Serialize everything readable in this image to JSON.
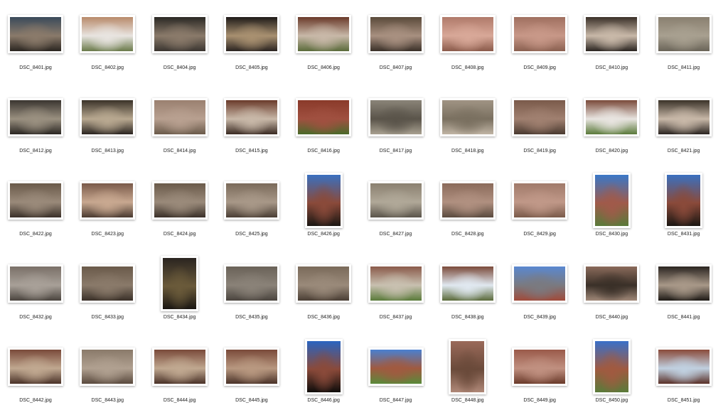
{
  "files": [
    {
      "name": "DSC_8401.jpg",
      "orientation": "landscape",
      "colors": [
        "#3a4a5a",
        "#8a7a6a",
        "#2a2520"
      ]
    },
    {
      "name": "DSC_8402.jpg",
      "orientation": "landscape",
      "colors": [
        "#b88a6a",
        "#e8e4e0",
        "#6a7a4a"
      ]
    },
    {
      "name": "DSC_8404.jpg",
      "orientation": "landscape",
      "colors": [
        "#2a2824",
        "#8a7a6a",
        "#3a3530"
      ]
    },
    {
      "name": "DSC_8405.jpg",
      "orientation": "landscape",
      "colors": [
        "#1e1a18",
        "#a89070",
        "#2a2420"
      ]
    },
    {
      "name": "DSC_8406.jpg",
      "orientation": "landscape",
      "colors": [
        "#6a3a2a",
        "#c8b8a8",
        "#5a6a3a"
      ]
    },
    {
      "name": "DSC_8407.jpg",
      "orientation": "landscape",
      "colors": [
        "#5a4a3a",
        "#a89080",
        "#3a3028"
      ]
    },
    {
      "name": "DSC_8408.jpg",
      "orientation": "landscape",
      "colors": [
        "#b07a6a",
        "#d8a898",
        "#8a5a4a"
      ]
    },
    {
      "name": "DSC_8409.jpg",
      "orientation": "landscape",
      "colors": [
        "#a07060",
        "#c89888",
        "#8a6050"
      ]
    },
    {
      "name": "DSC_8410.jpg",
      "orientation": "landscape",
      "colors": [
        "#3a3028",
        "#c8b8a8",
        "#2a2420"
      ]
    },
    {
      "name": "DSC_8411.jpg",
      "orientation": "landscape",
      "colors": [
        "#8a8070",
        "#a8a090",
        "#6a6458"
      ]
    },
    {
      "name": "DSC_8412.jpg",
      "orientation": "landscape",
      "colors": [
        "#3a3530",
        "#9a9080",
        "#2a2622"
      ]
    },
    {
      "name": "DSC_8413.jpg",
      "orientation": "landscape",
      "colors": [
        "#3a3228",
        "#b8a890",
        "#2a2420"
      ]
    },
    {
      "name": "DSC_8414.jpg",
      "orientation": "landscape",
      "colors": [
        "#9a8070",
        "#b8a090",
        "#6a5a4a"
      ]
    },
    {
      "name": "DSC_8415.jpg",
      "orientation": "landscape",
      "colors": [
        "#6a3a2a",
        "#c8b8a8",
        "#3a2a22"
      ]
    },
    {
      "name": "DSC_8416.jpg",
      "orientation": "landscape",
      "colors": [
        "#8a3a2a",
        "#a05040",
        "#4a6a2a"
      ]
    },
    {
      "name": "DSC_8417.jpg",
      "orientation": "landscape",
      "colors": [
        "#8a8478",
        "#5a544a",
        "#a8a090"
      ]
    },
    {
      "name": "DSC_8418.jpg",
      "orientation": "landscape",
      "colors": [
        "#a09484",
        "#7a7060",
        "#c0b4a4"
      ]
    },
    {
      "name": "DSC_8419.jpg",
      "orientation": "landscape",
      "colors": [
        "#7a5a4a",
        "#a08070",
        "#4a3a30"
      ]
    },
    {
      "name": "DSC_8420.jpg",
      "orientation": "landscape",
      "colors": [
        "#7a4a3a",
        "#e8e4e0",
        "#5a7a3a"
      ]
    },
    {
      "name": "DSC_8421.jpg",
      "orientation": "landscape",
      "colors": [
        "#3a3228",
        "#c8b8a8",
        "#2a2420"
      ]
    },
    {
      "name": "DSC_8422.jpg",
      "orientation": "landscape",
      "colors": [
        "#6a5a4a",
        "#9a8a7a",
        "#3a3028"
      ]
    },
    {
      "name": "DSC_8423.jpg",
      "orientation": "landscape",
      "colors": [
        "#7a5a4a",
        "#c8a890",
        "#4a3a30"
      ]
    },
    {
      "name": "DSC_8424.jpg",
      "orientation": "landscape",
      "colors": [
        "#6a5a4a",
        "#9a8a7a",
        "#3a3028"
      ]
    },
    {
      "name": "DSC_8425.jpg",
      "orientation": "landscape",
      "colors": [
        "#7a6a5a",
        "#a89888",
        "#4a3e34"
      ]
    },
    {
      "name": "DSC_8426.jpg",
      "orientation": "portrait",
      "colors": [
        "#3a70c0",
        "#8a4a3a",
        "#1a1612"
      ]
    },
    {
      "name": "DSC_8427.jpg",
      "orientation": "landscape",
      "colors": [
        "#8a8070",
        "#b0a898",
        "#5a544a"
      ]
    },
    {
      "name": "DSC_8428.jpg",
      "orientation": "landscape",
      "colors": [
        "#8a6a5a",
        "#b09080",
        "#5a4a3e"
      ]
    },
    {
      "name": "DSC_8429.jpg",
      "orientation": "landscape",
      "colors": [
        "#a07a6a",
        "#c09888",
        "#7a5a4a"
      ]
    },
    {
      "name": "DSC_8430.jpg",
      "orientation": "portrait",
      "colors": [
        "#3a78c8",
        "#a05a4a",
        "#5a7a3a"
      ]
    },
    {
      "name": "DSC_8431.jpg",
      "orientation": "portrait",
      "colors": [
        "#3a70c0",
        "#8a4a3a",
        "#1a1612"
      ]
    },
    {
      "name": "DSC_8432.jpg",
      "orientation": "landscape",
      "colors": [
        "#7a7068",
        "#a8a098",
        "#4a443e"
      ]
    },
    {
      "name": "DSC_8433.jpg",
      "orientation": "landscape",
      "colors": [
        "#6a5a4a",
        "#8a7a6a",
        "#3a3028"
      ]
    },
    {
      "name": "DSC_8434.jpg",
      "orientation": "portrait",
      "colors": [
        "#2a2420",
        "#6a5a3a",
        "#1a1612"
      ]
    },
    {
      "name": "DSC_8435.jpg",
      "orientation": "landscape",
      "colors": [
        "#6a6258",
        "#8a8278",
        "#4a443e"
      ]
    },
    {
      "name": "DSC_8436.jpg",
      "orientation": "landscape",
      "colors": [
        "#7a6a5a",
        "#9a8a7a",
        "#4a3e34"
      ]
    },
    {
      "name": "DSC_8437.jpg",
      "orientation": "landscape",
      "colors": [
        "#8a5a4a",
        "#c8c0b0",
        "#5a7a3a"
      ]
    },
    {
      "name": "DSC_8438.jpg",
      "orientation": "landscape",
      "colors": [
        "#7a4a3a",
        "#e0e8f0",
        "#5a6a3a"
      ]
    },
    {
      "name": "DSC_8439.jpg",
      "orientation": "landscape",
      "colors": [
        "#5a88d0",
        "#7a7a80",
        "#a04a3a"
      ]
    },
    {
      "name": "DSC_8440.jpg",
      "orientation": "landscape",
      "colors": [
        "#8a6a5a",
        "#3a3028",
        "#a08878"
      ]
    },
    {
      "name": "DSC_8441.jpg",
      "orientation": "landscape",
      "colors": [
        "#2a2420",
        "#a89888",
        "#1e1a16"
      ]
    },
    {
      "name": "DSC_8442.jpg",
      "orientation": "landscape",
      "colors": [
        "#7a4a3a",
        "#c0a890",
        "#4a3228"
      ]
    },
    {
      "name": "DSC_8443.jpg",
      "orientation": "landscape",
      "colors": [
        "#8a7a6a",
        "#b0a090",
        "#5a4a3e"
      ]
    },
    {
      "name": "DSC_8444.jpg",
      "orientation": "landscape",
      "colors": [
        "#7a4a3a",
        "#c0a890",
        "#4a3228"
      ]
    },
    {
      "name": "DSC_8445.jpg",
      "orientation": "landscape",
      "colors": [
        "#7a4a3a",
        "#b89880",
        "#4a3228"
      ]
    },
    {
      "name": "DSC_8446.jpg",
      "orientation": "portrait",
      "colors": [
        "#2a64c0",
        "#8a4a3a",
        "#0e0c0a"
      ]
    },
    {
      "name": "DSC_8447.jpg",
      "orientation": "landscape",
      "colors": [
        "#4a80d0",
        "#a05a40",
        "#5a8a3a"
      ]
    },
    {
      "name": "DSC_8448.jpg",
      "orientation": "portrait",
      "colors": [
        "#9a6a5a",
        "#6a4a3a",
        "#b08878"
      ]
    },
    {
      "name": "DSC_8449.jpg",
      "orientation": "landscape",
      "colors": [
        "#9a5a4a",
        "#c09080",
        "#6a3a2a"
      ]
    },
    {
      "name": "DSC_8450.jpg",
      "orientation": "portrait",
      "colors": [
        "#3a70c8",
        "#a05a40",
        "#5a7a3a"
      ]
    },
    {
      "name": "DSC_8451.jpg",
      "orientation": "landscape",
      "colors": [
        "#8a4a3a",
        "#c0d0e0",
        "#5a3028"
      ]
    }
  ]
}
